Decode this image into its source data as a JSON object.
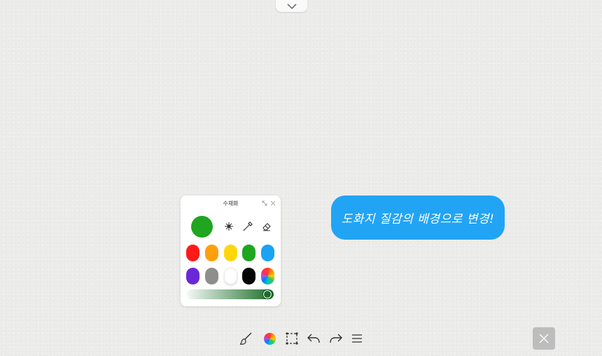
{
  "panel": {
    "title": "수채화",
    "current_color": "#1fa51f",
    "tools": [
      "sparkle-brush-icon",
      "dropper-icon",
      "eraser-icon"
    ],
    "swatches": [
      {
        "name": "red",
        "color": "#ff1a1a"
      },
      {
        "name": "orange",
        "color": "#ff9f0a"
      },
      {
        "name": "yellow",
        "color": "#ffd60a"
      },
      {
        "name": "green",
        "color": "#1fa51f"
      },
      {
        "name": "blue",
        "color": "#1aa3f5"
      },
      {
        "name": "purple",
        "color": "#6a28d8"
      },
      {
        "name": "gray",
        "color": "#8e8e8c"
      },
      {
        "name": "white",
        "color": "#ffffff"
      },
      {
        "name": "black",
        "color": "#050505"
      },
      {
        "name": "multicolor",
        "color": "conic"
      }
    ],
    "opacity": 1.0
  },
  "bubble": {
    "text": "도화지 질감의 배경으로 변경!"
  },
  "toolbar": {
    "items": [
      "brush-icon",
      "color-wheel-icon",
      "select-icon",
      "undo-icon",
      "redo-icon",
      "menu-icon"
    ]
  },
  "colors": {
    "accent": "#22a4f5",
    "close_button": "#bdbdbd"
  }
}
